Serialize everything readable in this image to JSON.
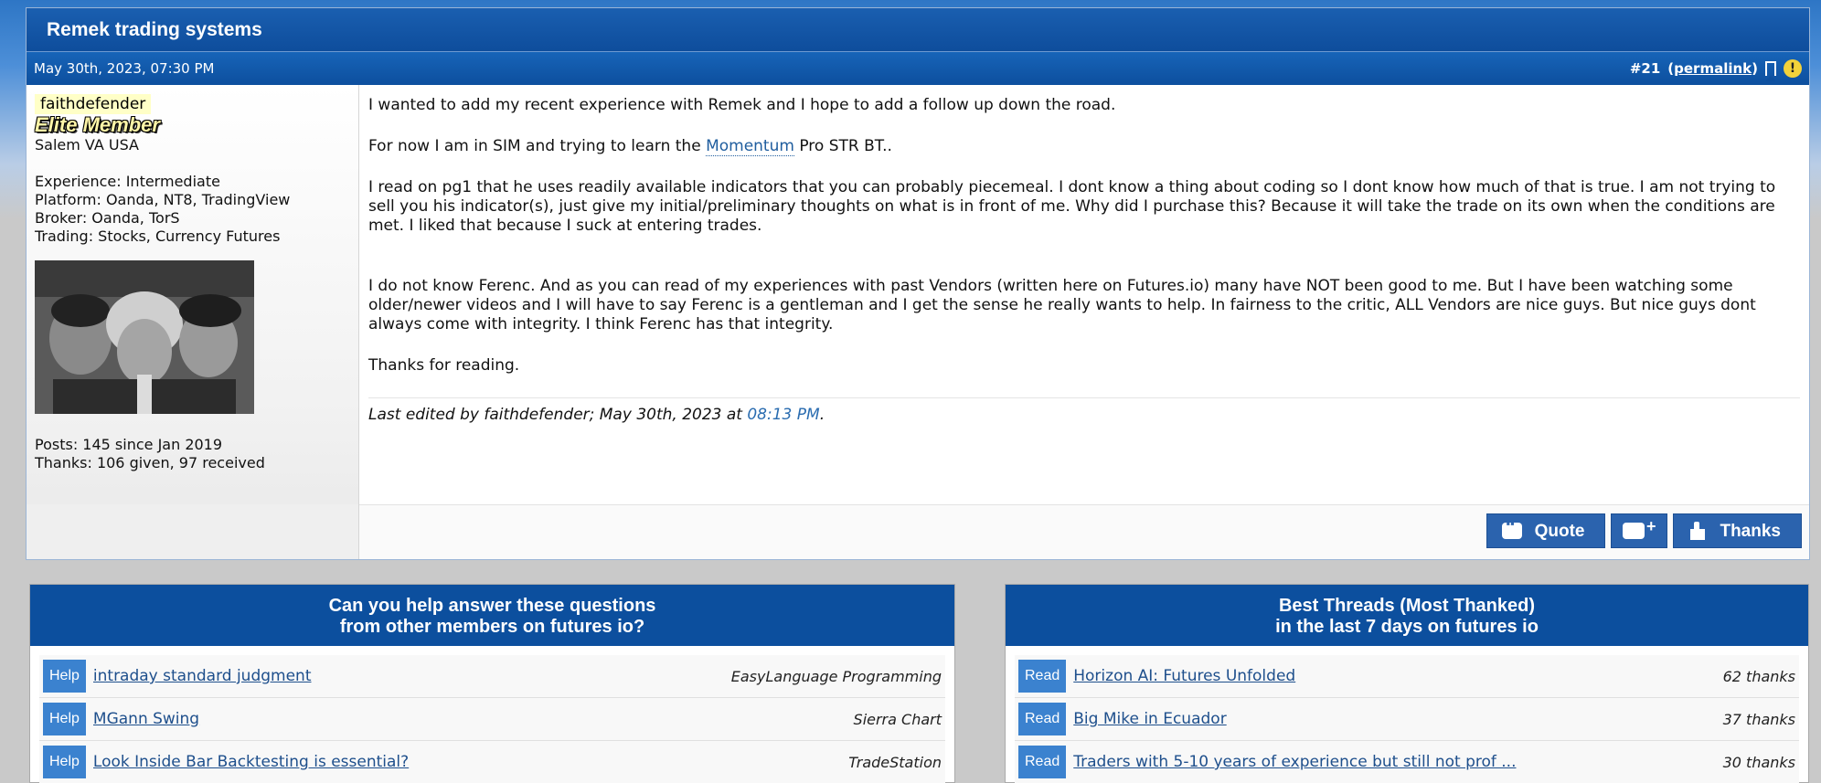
{
  "colors": {
    "header_blue": "#0e4d9c",
    "tag_blue": "#3b82cf",
    "link_blue": "#1e4f8c",
    "username_highlight": "#ffffc7"
  },
  "thread": {
    "title": "Remek trading systems"
  },
  "post": {
    "date": "May 30th, 2023, 07:30 PM",
    "number": "#21",
    "permalink_label": "permalink",
    "icons": [
      "bookmark-icon",
      "warning-icon"
    ],
    "user": {
      "username": "faithdefender",
      "rank": "Elite Member",
      "location": "Salem VA USA",
      "experience": "Experience: Intermediate",
      "platform": "Platform: Oanda, NT8, TradingView",
      "broker": "Broker: Oanda, TorS",
      "trading": "Trading: Stocks, Currency Futures",
      "posts": "Posts: 145 since Jan 2019",
      "thanks": "Thanks: 106 given, 97 received"
    },
    "content": {
      "p1": "I wanted to add my recent experience with Remek and I hope to add a follow up down the road.",
      "p2_before": "For now I am in SIM and trying to learn the ",
      "p2_link": "Momentum",
      "p2_after": " Pro STR BT..",
      "p3": "I read on pg1 that he uses readily available indicators that you can probably piecemeal. I dont know a thing about coding so I dont know how much of that is true. I am not trying to sell you his indicator(s), just give my initial/preliminary thoughts on what is in front of me. Why did I purchase this? Because it will take the trade on its own when the conditions are met. I liked that because I suck at entering trades.",
      "p4": "I do not know Ferenc. And as you can read of my experiences with past Vendors (written here on Futures.io) many have NOT been good to me. But I have been watching some older/newer videos and I will have to say Ferenc is a gentleman and I get the sense he really wants to help. In fairness to the critic, ALL Vendors are nice guys. But nice guys dont always come with integrity. I think Ferenc has that integrity.",
      "p5": "Thanks for reading.",
      "edited_prefix": "Last edited by faithdefender; May 30th, 2023 at ",
      "edited_time": "08:13 PM",
      "edited_suffix": "."
    },
    "actions": {
      "quote_label": "Quote",
      "thanks_label": "Thanks"
    }
  },
  "help_box": {
    "title_line1": "Can you help answer these questions",
    "title_line2": "from other members on futures io?",
    "items": [
      {
        "tag": "Help",
        "title": "intraday standard judgment",
        "meta": "EasyLanguage Programming"
      },
      {
        "tag": "Help",
        "title": "MGann Swing",
        "meta": "Sierra Chart"
      },
      {
        "tag": "Help",
        "title": "Look Inside Bar Backtesting is essential?",
        "meta": "TradeStation"
      }
    ]
  },
  "best_box": {
    "title_line1": "Best Threads (Most Thanked)",
    "title_line2": "in the last 7 days on futures io",
    "items": [
      {
        "tag": "Read",
        "title": "Horizon AI: Futures Unfolded",
        "meta": "62 thanks"
      },
      {
        "tag": "Read",
        "title": "Big Mike in Ecuador",
        "meta": "37 thanks"
      },
      {
        "tag": "Read",
        "title": "Traders with 5-10 years of experience but still not prof ...",
        "meta": "30 thanks"
      }
    ]
  }
}
